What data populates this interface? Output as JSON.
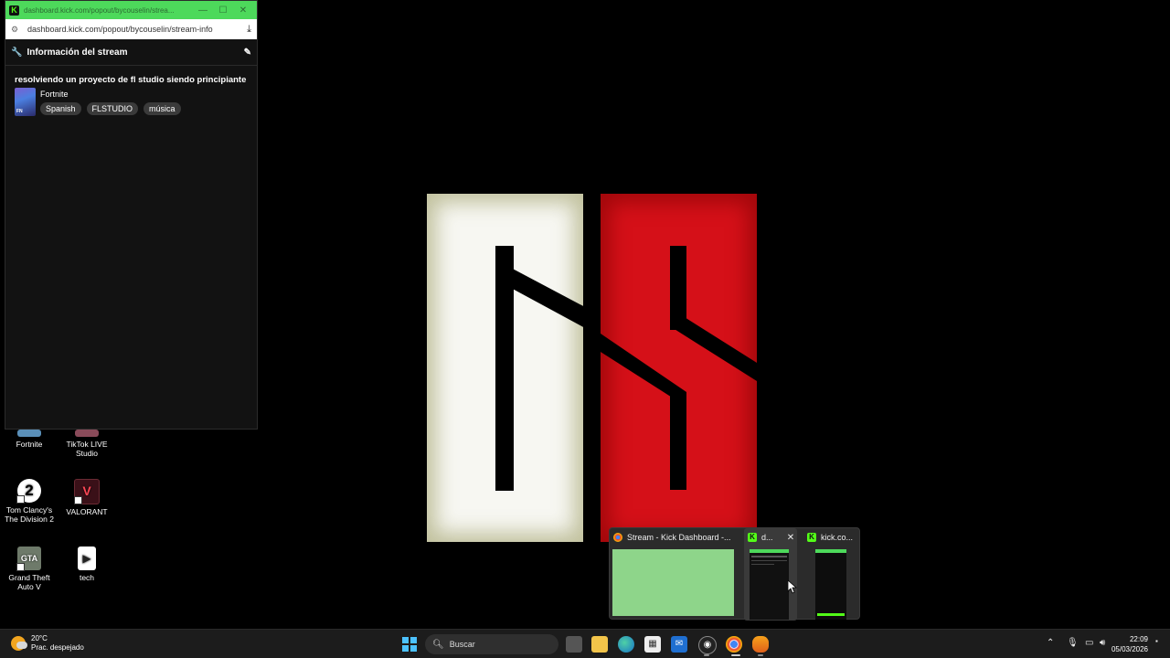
{
  "popout": {
    "window_title": "dashboard.kick.com/popout/bycouselin/strea...",
    "url": "dashboard.kick.com/popout/bycouselin/stream-info",
    "panel_title": "Información del stream",
    "stream_title": "resolviendo un proyecto de fl studio siendo principiante",
    "category": "Fortnite",
    "tags": [
      "Spanish",
      "FLSTUDIO",
      "música"
    ]
  },
  "desktop_icons": [
    {
      "label": "Fortnite"
    },
    {
      "label": "TikTok LIVE Studio"
    },
    {
      "label": "Tom Clancy's The Division 2"
    },
    {
      "label": "VALORANT"
    },
    {
      "label": "Grand Theft Auto V"
    },
    {
      "label": "tech"
    }
  ],
  "preview": {
    "tabs": [
      {
        "label": "Stream - Kick Dashboard -...",
        "icon": "chrome-icon"
      },
      {
        "label": "d...",
        "icon": "kick-icon"
      },
      {
        "label": "kick.co...",
        "icon": "kick-icon"
      }
    ]
  },
  "taskbar": {
    "weather_temp": "20°C",
    "weather_cond": "Prac. despejado",
    "search_placeholder": "Buscar",
    "time": "22:09",
    "date": "05/03/2026"
  },
  "colors": {
    "kick_green": "#53fc18",
    "logo_red": "#d51018",
    "logo_white": "#f7f7f2",
    "start_blue": "#4cc2ff"
  }
}
